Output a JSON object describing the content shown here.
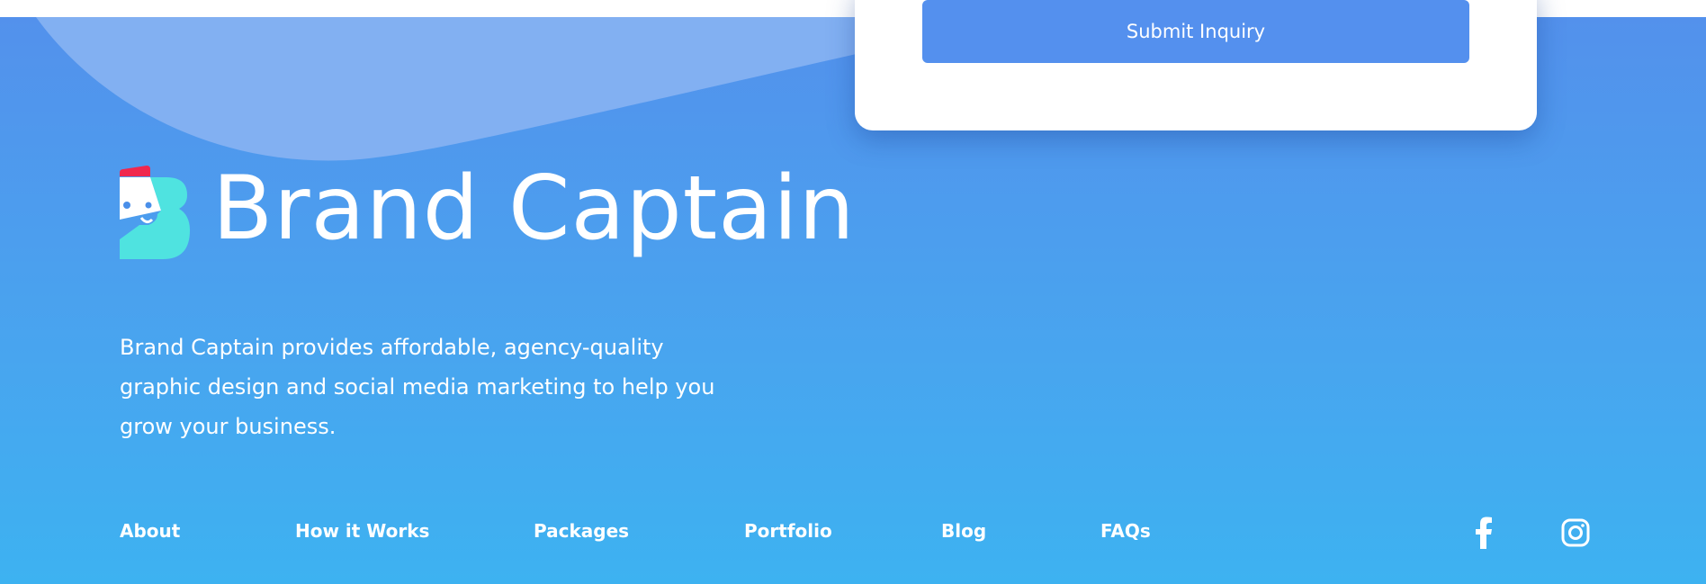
{
  "form": {
    "submit_label": "Submit Inquiry"
  },
  "brand": {
    "name": "Brand Captain",
    "description": "Brand Captain provides affordable, agency-quality graphic design and social media marketing to help you grow your business."
  },
  "nav": [
    {
      "label": "About"
    },
    {
      "label": "How it Works"
    },
    {
      "label": "Packages"
    },
    {
      "label": "Portfolio"
    },
    {
      "label": "Blog"
    },
    {
      "label": "FAQs"
    }
  ],
  "social": [
    {
      "icon": "facebook-icon"
    },
    {
      "icon": "instagram-icon"
    }
  ],
  "colors": {
    "gradient_top": "#5391ec",
    "gradient_bottom": "#3db2f1",
    "button": "#5490ee",
    "logo_teal": "#4fe3e0",
    "logo_red": "#f0284e"
  }
}
